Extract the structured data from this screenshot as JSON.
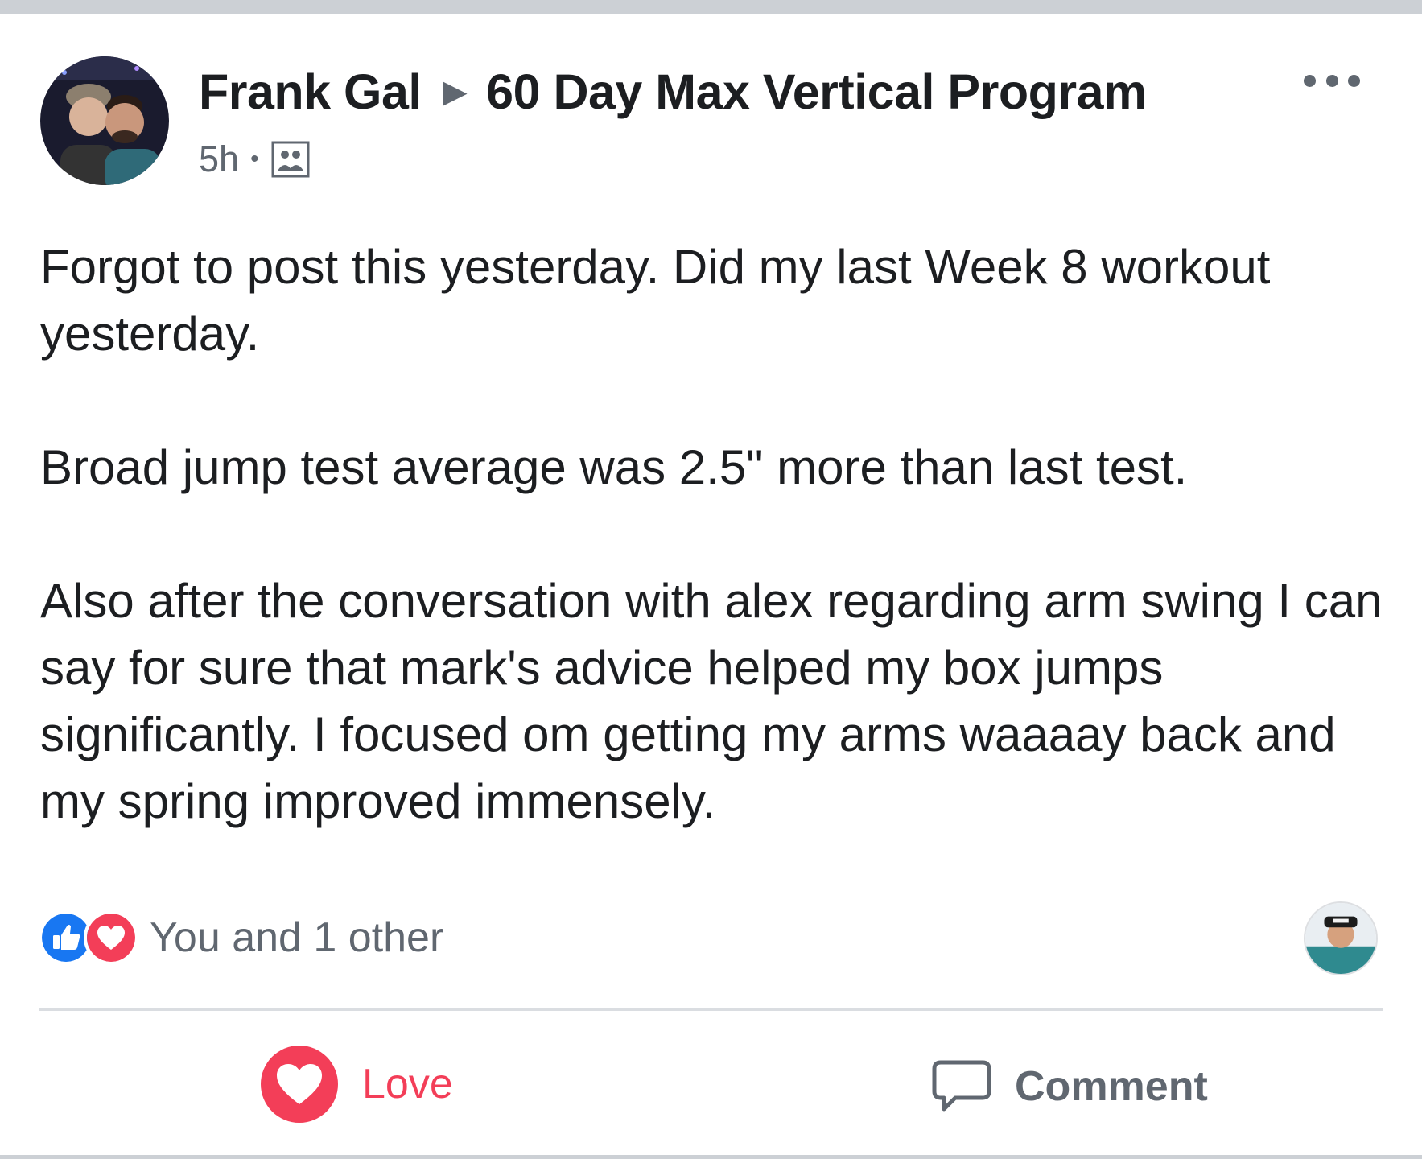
{
  "post": {
    "author": "Frank Gal",
    "group": "60 Day Max Vertical Program",
    "time": "5h",
    "privacy_icon": "group-icon",
    "body": [
      "Forgot to post this yesterday. Did my last Week 8 workout yesterday.",
      "Broad jump test average was 2.5\" more than last test.",
      "Also after the conversation with alex regarding arm swing I can say for sure that mark's advice helped my box jumps significantly. I focused om getting my arms waaaay back and my spring improved immensely."
    ]
  },
  "reactions": {
    "icons": [
      "like-icon",
      "love-icon"
    ],
    "summary": "You and 1 other"
  },
  "actions": {
    "love_label": "Love",
    "comment_label": "Comment"
  },
  "colors": {
    "like": "#1877f2",
    "love": "#f33e58",
    "secondary_text": "#606770",
    "divider": "#dadde1"
  }
}
